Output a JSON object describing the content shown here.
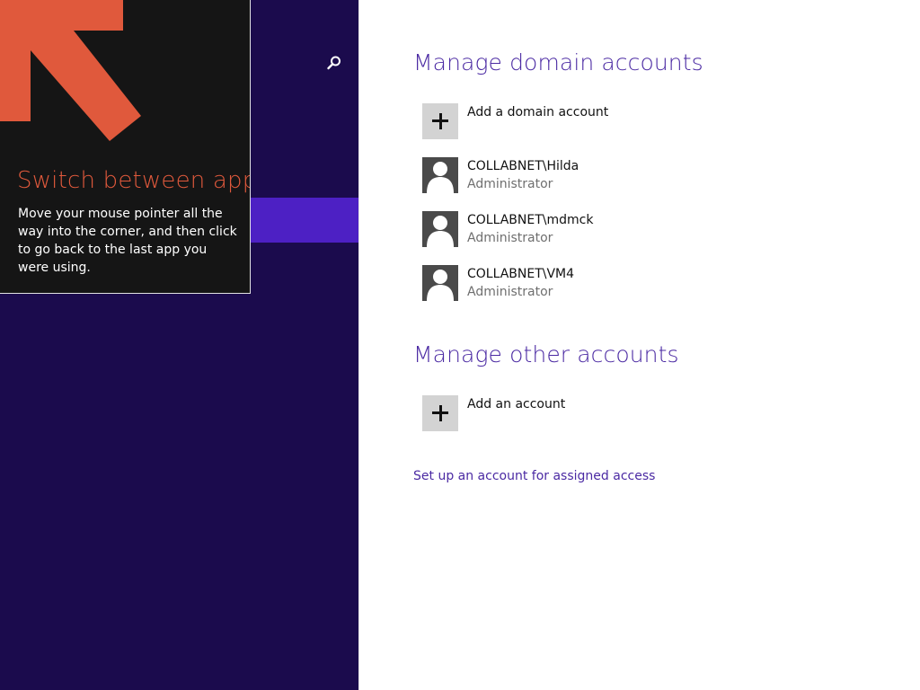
{
  "left": {
    "search_icon": "search-icon"
  },
  "tip": {
    "title": "Switch between apps",
    "body": "Move your mouse pointer all the way into the corner, and then click to go back to the last app you were using.",
    "arrow_color": "#e0593c"
  },
  "main": {
    "domain_section_title": "Manage domain accounts",
    "add_domain_label": "Add a domain account",
    "accounts": [
      {
        "name": "COLLABNET\\Hilda",
        "role": "Administrator"
      },
      {
        "name": "COLLABNET\\mdmck",
        "role": "Administrator"
      },
      {
        "name": "COLLABNET\\VM4",
        "role": "Administrator"
      }
    ],
    "other_section_title": "Manage other accounts",
    "add_account_label": "Add an account",
    "assigned_access_link": "Set up an account for assigned access"
  },
  "colors": {
    "left_bg": "#1b0b4d",
    "selection": "#4d20c4",
    "accent_text": "#4b2aa3",
    "tip_title": "#e0593c"
  }
}
